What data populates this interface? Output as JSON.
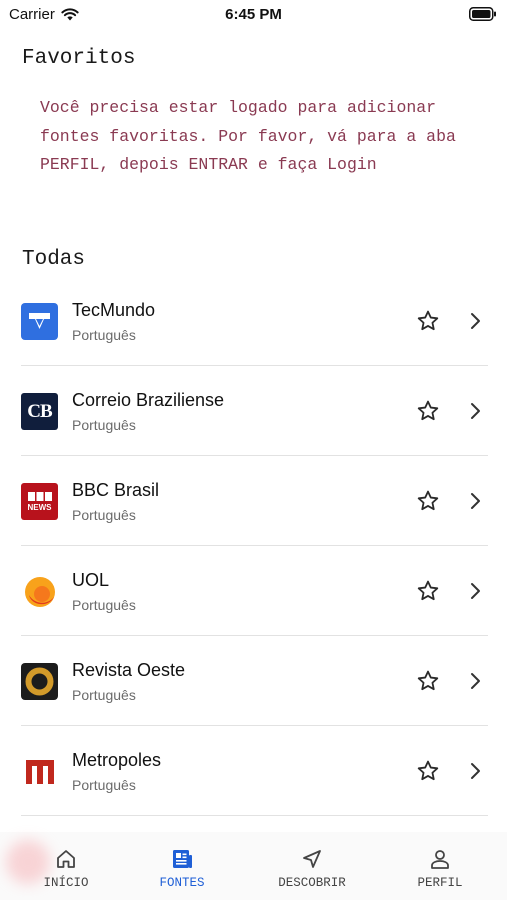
{
  "status_bar": {
    "carrier": "Carrier",
    "time": "6:45 PM"
  },
  "favorites": {
    "title": "Favoritos",
    "message": "Você precisa estar logado para adicionar fontes favoritas. Por favor, vá para a aba PERFIL, depois ENTRAR e faça Login"
  },
  "all_sources": {
    "title": "Todas",
    "items": [
      {
        "name": "TecMundo",
        "language": "Português",
        "logo": "tecmundo-logo",
        "logo_bg": "#2f6fe0"
      },
      {
        "name": "Correio Braziliense",
        "language": "Português",
        "logo": "correio-braziliense-logo",
        "logo_bg": "#101e3c",
        "logo_text": "CB"
      },
      {
        "name": "BBC Brasil",
        "language": "Português",
        "logo": "bbc-brasil-logo",
        "logo_bg": "#b8121c",
        "logo_text": "NEWS"
      },
      {
        "name": "UOL",
        "language": "Português",
        "logo": "uol-logo",
        "logo_bg": "#f8a21b"
      },
      {
        "name": "Revista Oeste",
        "language": "Português",
        "logo": "revista-oeste-logo",
        "logo_bg": "#1c1c1c"
      },
      {
        "name": "Metropoles",
        "language": "Português",
        "logo": "metropoles-logo",
        "logo_bg": "#c0281d"
      }
    ]
  },
  "tab_bar": {
    "tabs": [
      {
        "label": "INÍCIO",
        "icon": "home-icon"
      },
      {
        "label": "FONTES",
        "icon": "news-icon",
        "active": true
      },
      {
        "label": "DESCOBRIR",
        "icon": "navigation-arrow-icon"
      },
      {
        "label": "PERFIL",
        "icon": "person-icon"
      }
    ],
    "active_color": "#1f5fd6"
  },
  "colors": {
    "message": "#8a3a52",
    "divider": "#e2e2e2"
  }
}
